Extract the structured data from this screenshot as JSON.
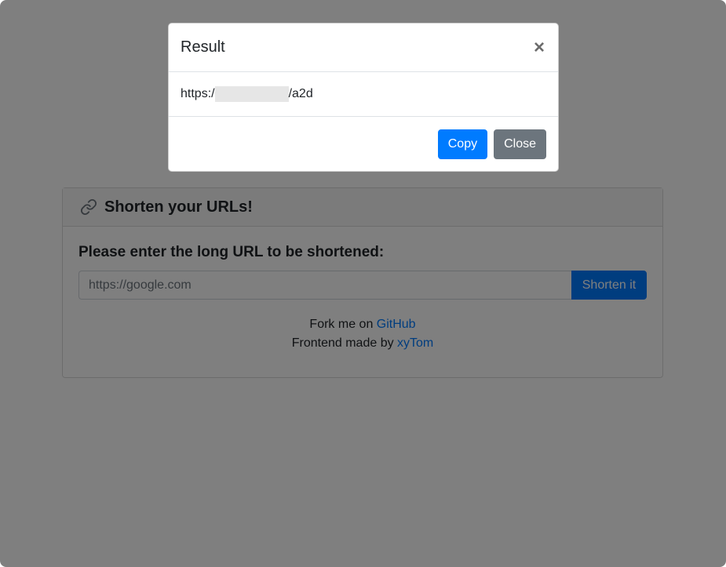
{
  "page": {
    "card_title": "Shorten your URLs!",
    "link_icon": "link-icon",
    "form_label": "Please enter the long URL to be shortened:",
    "input_placeholder": "https://google.com",
    "shorten_label": "Shorten it",
    "fork_text": "Fork me on ",
    "github_link": "GitHub",
    "frontend_text": "Frontend made by ",
    "author_link": "xyTom"
  },
  "modal": {
    "title": "Result",
    "close_symbol": "×",
    "url_prefix": "https:/",
    "url_suffix": "/a2d",
    "copy_label": "Copy",
    "close_label": "Close"
  },
  "colors": {
    "primary": "#007bff",
    "secondary": "#6c757d",
    "backdrop": "rgba(0,0,0,0.5)"
  }
}
